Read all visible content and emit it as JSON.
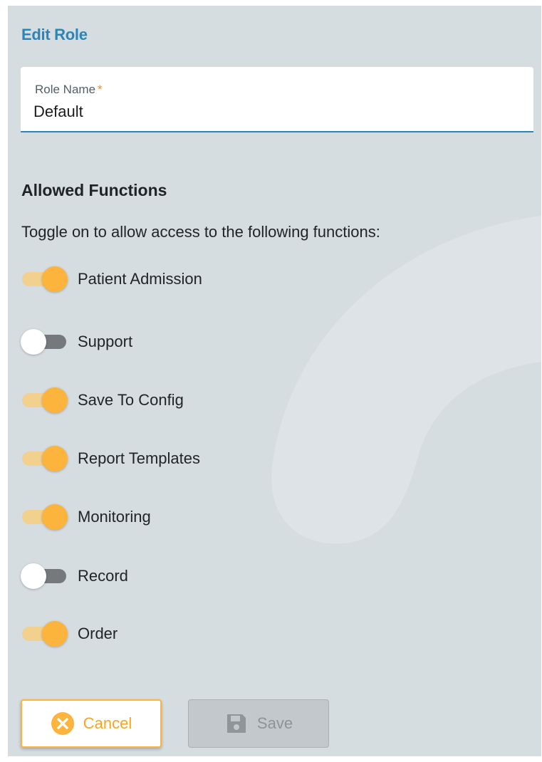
{
  "dialog": {
    "title": "Edit Role"
  },
  "role_name_field": {
    "label": "Role Name",
    "required_marker": "*",
    "value": "Default"
  },
  "allowed_functions": {
    "heading": "Allowed Functions",
    "description": "Toggle on to allow access to the following functions:",
    "items": [
      {
        "label": "Patient Admission",
        "enabled": true
      },
      {
        "label": "Support",
        "enabled": false
      },
      {
        "label": "Save To Config",
        "enabled": true
      },
      {
        "label": "Report Templates",
        "enabled": true
      },
      {
        "label": "Monitoring",
        "enabled": true
      },
      {
        "label": "Record",
        "enabled": false
      },
      {
        "label": "Order",
        "enabled": true
      }
    ]
  },
  "actions": {
    "cancel_label": "Cancel",
    "save_label": "Save",
    "save_disabled": true
  },
  "colors": {
    "accent_blue": "#2a86b8",
    "toggle_on": "#fcb43c",
    "toggle_on_track": "#f2d08e",
    "toggle_off_track": "#76797b",
    "required": "#f08a24",
    "panel_bg": "#d6dde1"
  },
  "icons": {
    "cancel": "close-circle-icon",
    "save": "floppy-disk-icon"
  }
}
